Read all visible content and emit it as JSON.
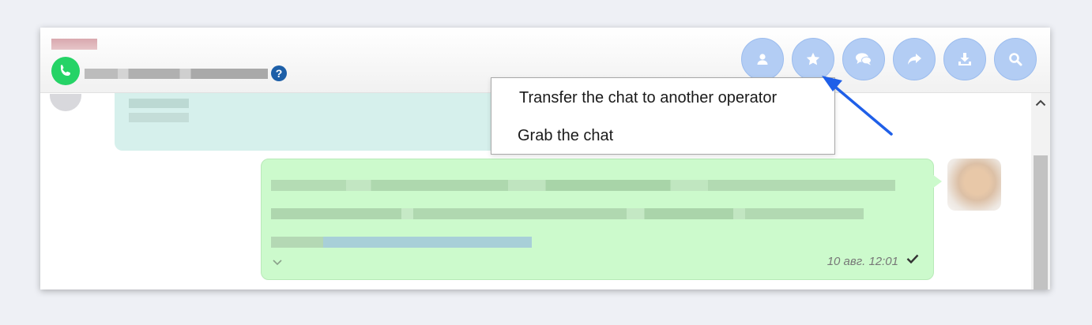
{
  "toolbar": {
    "buttons": [
      {
        "name": "user-icon"
      },
      {
        "name": "star-icon"
      },
      {
        "name": "chat-bubbles-icon"
      },
      {
        "name": "forward-arrow-icon"
      },
      {
        "name": "download-icon"
      },
      {
        "name": "search-icon"
      }
    ]
  },
  "header": {
    "help_glyph": "?",
    "contact_icon": "whatsapp-icon"
  },
  "dropdown": {
    "items": [
      {
        "label": "Transfer the chat to another operator"
      },
      {
        "label": "Grab the chat"
      }
    ]
  },
  "messages": {
    "outgoing": {
      "time": "10 авг. 12:01",
      "status_icon": "checkmark-icon"
    }
  },
  "colors": {
    "toolbar_button": "#b3cdf4",
    "incoming_bubble": "#d6f0ec",
    "outgoing_bubble": "#ccfacc",
    "whatsapp_green": "#25d366",
    "annotation_arrow": "#1f5fe8"
  }
}
